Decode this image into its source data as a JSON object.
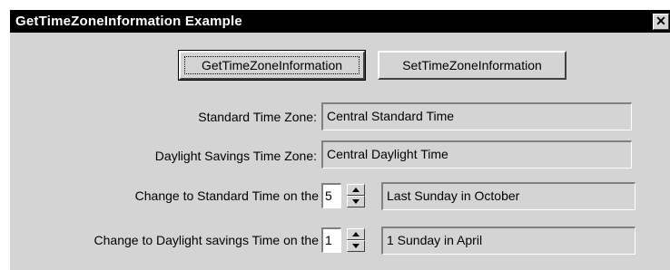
{
  "window": {
    "title": "GetTimeZoneInformation Example",
    "close_glyph": "✕"
  },
  "buttons": {
    "get_label": "GetTimeZoneInformation",
    "set_label": "SetTimeZoneInformation"
  },
  "fields": {
    "standard_label": "Standard Time Zone:",
    "standard_value": "Central Standard Time",
    "daylight_label": "Daylight Savings Time Zone:",
    "daylight_value": "Central Daylight Time"
  },
  "changes": {
    "standard_label": "Change to Standard Time on the",
    "standard_week": "5",
    "standard_desc": "Last Sunday in October",
    "daylight_label": "Change to Daylight savings Time on the",
    "daylight_week": "1",
    "daylight_desc": "1 Sunday in April"
  }
}
